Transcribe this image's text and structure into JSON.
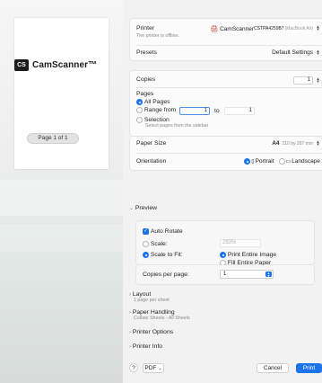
{
  "preview": {
    "logo_mark": "CS",
    "logo_text": "CamScanner™",
    "page_indicator": "Page 1 of 1"
  },
  "printer": {
    "label": "Printer",
    "status": "The printer is offline.",
    "name": "CamScanner",
    "model": "CSTPA4259B7",
    "model_note": "(MacBook Air)"
  },
  "presets": {
    "label": "Presets",
    "value": "Default Settings"
  },
  "copies": {
    "label": "Copies",
    "value": "1"
  },
  "pages": {
    "label": "Pages",
    "all_pages": "All Pages",
    "range_from": "Range from",
    "range_from_value": "1",
    "to": "to",
    "range_to_value": "1",
    "selection": "Selection",
    "selection_hint": "Select pages from the sidebar"
  },
  "paper_size": {
    "label": "Paper Size",
    "value": "A4",
    "dims": "210 by 297 mm"
  },
  "orientation": {
    "label": "Orientation",
    "portrait": "Portrait",
    "landscape": "Landscape"
  },
  "preview_section": {
    "title": "Preview",
    "auto_rotate": "Auto Rotate",
    "scale": "Scale:",
    "scale_value": "293%",
    "scale_to_fit": "Scale to Fit:",
    "print_entire_image": "Print Entire Image",
    "fill_entire_paper": "Fill Entire Paper",
    "copies_per_page": "Copies per page:",
    "copies_per_page_value": "1"
  },
  "layout": {
    "title": "Layout",
    "sub": "1 page per sheet"
  },
  "paper_handling": {
    "title": "Paper Handling",
    "sub": "Collate Sheets - All Sheets"
  },
  "printer_options": {
    "title": "Printer Options"
  },
  "printer_info": {
    "title": "Printer Info"
  },
  "footer": {
    "help": "?",
    "pdf": "PDF",
    "cancel": "Cancel",
    "print": "Print"
  },
  "colors": {
    "accent": "#1a73e8",
    "background": "#f2f2f2"
  }
}
